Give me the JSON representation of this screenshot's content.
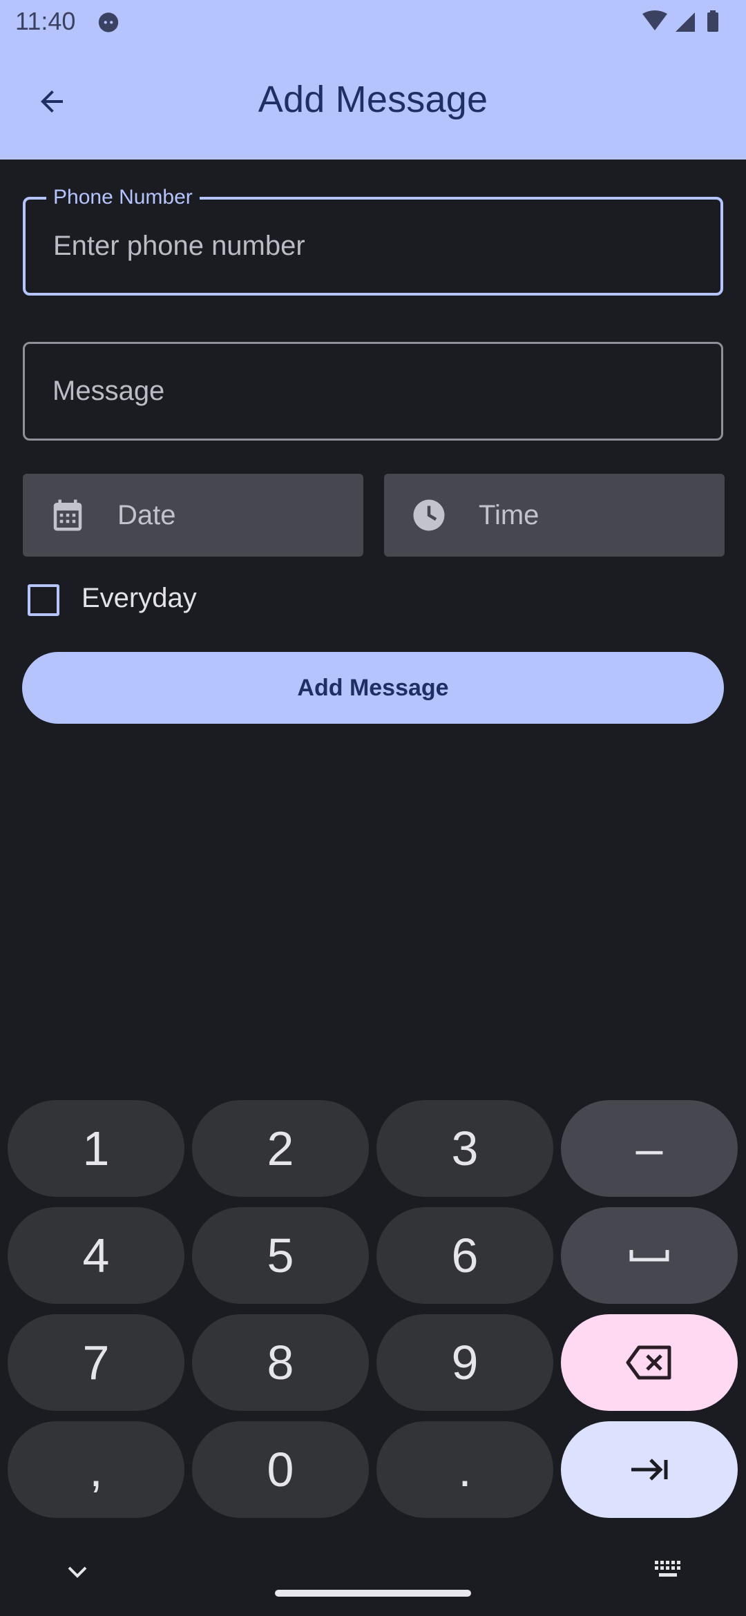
{
  "status_bar": {
    "time": "11:40",
    "icons": [
      "cat-notification-icon",
      "wifi-icon",
      "signal-icon",
      "battery-icon"
    ]
  },
  "app_bar": {
    "title": "Add Message",
    "back_icon": "arrow-back-icon"
  },
  "form": {
    "phone": {
      "label": "Phone Number",
      "placeholder": "Enter phone number",
      "value": ""
    },
    "message": {
      "placeholder": "Message",
      "value": ""
    },
    "date": {
      "label": "Date",
      "icon": "calendar-icon"
    },
    "time": {
      "label": "Time",
      "icon": "clock-icon"
    },
    "everyday": {
      "label": "Everyday",
      "checked": false
    },
    "submit_label": "Add Message"
  },
  "keyboard": {
    "keys": [
      "1",
      "2",
      "3",
      "–",
      "4",
      "5",
      "6",
      "␣",
      "7",
      "8",
      "9",
      "⌫",
      ",",
      "0",
      ".",
      "⇥"
    ],
    "collapse_icon": "chevron-down-icon",
    "switch_icon": "keyboard-icon"
  },
  "colors": {
    "background": "#1b1c22",
    "primary_container": "#b5c4fd",
    "on_primary": "#1f2f63",
    "field_fill": "#47484f",
    "key": "#333438",
    "delete_key": "#ffd8f2",
    "enter_key": "#dce1fe"
  }
}
